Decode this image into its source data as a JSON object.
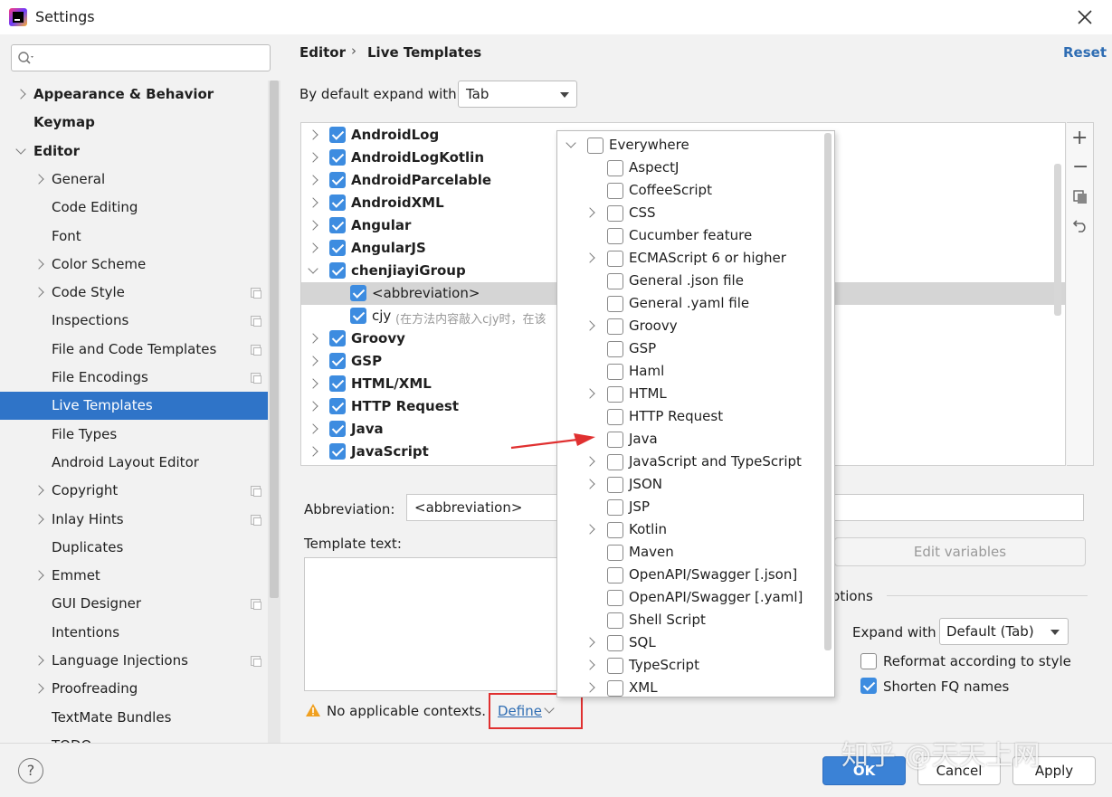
{
  "window": {
    "title": "Settings",
    "close_icon": "close-icon"
  },
  "search": {
    "placeholder": "",
    "value": ""
  },
  "nav": {
    "items": [
      {
        "label": "Appearance & Behavior",
        "level": 0,
        "bold": true,
        "expander": "right",
        "badge": false
      },
      {
        "label": "Keymap",
        "level": 0,
        "bold": true,
        "expander": "none",
        "badge": false
      },
      {
        "label": "Editor",
        "level": 0,
        "bold": true,
        "expander": "down",
        "badge": false
      },
      {
        "label": "General",
        "level": 1,
        "bold": false,
        "expander": "right",
        "badge": false
      },
      {
        "label": "Code Editing",
        "level": 1,
        "bold": false,
        "expander": "none",
        "badge": false
      },
      {
        "label": "Font",
        "level": 1,
        "bold": false,
        "expander": "none",
        "badge": false
      },
      {
        "label": "Color Scheme",
        "level": 1,
        "bold": false,
        "expander": "right",
        "badge": false
      },
      {
        "label": "Code Style",
        "level": 1,
        "bold": false,
        "expander": "right",
        "badge": true
      },
      {
        "label": "Inspections",
        "level": 1,
        "bold": false,
        "expander": "none",
        "badge": true
      },
      {
        "label": "File and Code Templates",
        "level": 1,
        "bold": false,
        "expander": "none",
        "badge": true
      },
      {
        "label": "File Encodings",
        "level": 1,
        "bold": false,
        "expander": "none",
        "badge": true
      },
      {
        "label": "Live Templates",
        "level": 1,
        "bold": false,
        "expander": "none",
        "badge": false,
        "selected": true
      },
      {
        "label": "File Types",
        "level": 1,
        "bold": false,
        "expander": "none",
        "badge": false
      },
      {
        "label": "Android Layout Editor",
        "level": 1,
        "bold": false,
        "expander": "none",
        "badge": false
      },
      {
        "label": "Copyright",
        "level": 1,
        "bold": false,
        "expander": "right",
        "badge": true
      },
      {
        "label": "Inlay Hints",
        "level": 1,
        "bold": false,
        "expander": "right",
        "badge": true
      },
      {
        "label": "Duplicates",
        "level": 1,
        "bold": false,
        "expander": "none",
        "badge": false
      },
      {
        "label": "Emmet",
        "level": 1,
        "bold": false,
        "expander": "right",
        "badge": false
      },
      {
        "label": "GUI Designer",
        "level": 1,
        "bold": false,
        "expander": "none",
        "badge": true
      },
      {
        "label": "Intentions",
        "level": 1,
        "bold": false,
        "expander": "none",
        "badge": false
      },
      {
        "label": "Language Injections",
        "level": 1,
        "bold": false,
        "expander": "right",
        "badge": true
      },
      {
        "label": "Proofreading",
        "level": 1,
        "bold": false,
        "expander": "right",
        "badge": false
      },
      {
        "label": "TextMate Bundles",
        "level": 1,
        "bold": false,
        "expander": "none",
        "badge": false
      },
      {
        "label": "TODO",
        "level": 1,
        "bold": false,
        "expander": "none",
        "badge": false
      }
    ]
  },
  "header": {
    "crumb1": "Editor",
    "sep": "›",
    "crumb2": "Live Templates",
    "reset": "Reset"
  },
  "expand": {
    "label": "By default expand with",
    "value": "Tab"
  },
  "templates": [
    {
      "label": "AndroidLog",
      "bold": true,
      "expander": "right",
      "checked": true,
      "indent": 0
    },
    {
      "label": "AndroidLogKotlin",
      "bold": true,
      "expander": "right",
      "checked": true,
      "indent": 0
    },
    {
      "label": "AndroidParcelable",
      "bold": true,
      "expander": "right",
      "checked": true,
      "indent": 0
    },
    {
      "label": "AndroidXML",
      "bold": true,
      "expander": "right",
      "checked": true,
      "indent": 0
    },
    {
      "label": "Angular",
      "bold": true,
      "expander": "right",
      "checked": true,
      "indent": 0
    },
    {
      "label": "AngularJS",
      "bold": true,
      "expander": "right",
      "checked": true,
      "indent": 0
    },
    {
      "label": "chenjiayiGroup",
      "bold": true,
      "expander": "down",
      "checked": true,
      "indent": 0
    },
    {
      "label": "<abbreviation>",
      "bold": false,
      "expander": "none",
      "checked": true,
      "indent": 1,
      "selected": true
    },
    {
      "label": "cjy",
      "desc": "(在方法内容敲入cjy时，在该",
      "bold": false,
      "expander": "none",
      "checked": true,
      "indent": 1
    },
    {
      "label": "Groovy",
      "bold": true,
      "expander": "right",
      "checked": true,
      "indent": 0
    },
    {
      "label": "GSP",
      "bold": true,
      "expander": "right",
      "checked": true,
      "indent": 0
    },
    {
      "label": "HTML/XML",
      "bold": true,
      "expander": "right",
      "checked": true,
      "indent": 0
    },
    {
      "label": "HTTP Request",
      "bold": true,
      "expander": "right",
      "checked": true,
      "indent": 0
    },
    {
      "label": "Java",
      "bold": true,
      "expander": "right",
      "checked": true,
      "indent": 0
    },
    {
      "label": "JavaScript",
      "bold": true,
      "expander": "right",
      "checked": true,
      "indent": 0
    }
  ],
  "side_toolbar": {
    "add": "+",
    "remove": "−"
  },
  "form": {
    "abbr_label": "Abbreviation:",
    "abbr_value": "<abbreviation>",
    "template_label": "Template text:",
    "edit_vars": "Edit variables",
    "options_label": "Options",
    "expand_with_label": "Expand with",
    "expand_with_value": "Default (Tab)",
    "reformat_label": "Reformat according to style",
    "reformat_checked": false,
    "shorten_label": "Shorten FQ names",
    "shorten_checked": true,
    "warning_text": "No applicable contexts.",
    "define_label": "Define"
  },
  "context_popup": {
    "items": [
      {
        "label": "Everywhere",
        "expander": "down",
        "indent": 0
      },
      {
        "label": "AspectJ",
        "expander": "none",
        "indent": 1
      },
      {
        "label": "CoffeeScript",
        "expander": "none",
        "indent": 1
      },
      {
        "label": "CSS",
        "expander": "right",
        "indent": 1
      },
      {
        "label": "Cucumber feature",
        "expander": "none",
        "indent": 1
      },
      {
        "label": "ECMAScript 6 or higher",
        "expander": "right",
        "indent": 1
      },
      {
        "label": "General .json file",
        "expander": "none",
        "indent": 1
      },
      {
        "label": "General .yaml file",
        "expander": "none",
        "indent": 1
      },
      {
        "label": "Groovy",
        "expander": "right",
        "indent": 1
      },
      {
        "label": "GSP",
        "expander": "none",
        "indent": 1
      },
      {
        "label": "Haml",
        "expander": "none",
        "indent": 1
      },
      {
        "label": "HTML",
        "expander": "right",
        "indent": 1
      },
      {
        "label": "HTTP Request",
        "expander": "none",
        "indent": 1
      },
      {
        "label": "Java",
        "expander": "none",
        "indent": 1
      },
      {
        "label": "JavaScript and TypeScript",
        "expander": "right",
        "indent": 1
      },
      {
        "label": "JSON",
        "expander": "right",
        "indent": 1
      },
      {
        "label": "JSP",
        "expander": "none",
        "indent": 1
      },
      {
        "label": "Kotlin",
        "expander": "right",
        "indent": 1
      },
      {
        "label": "Maven",
        "expander": "none",
        "indent": 1
      },
      {
        "label": "OpenAPI/Swagger [.json]",
        "expander": "none",
        "indent": 1
      },
      {
        "label": "OpenAPI/Swagger [.yaml]",
        "expander": "none",
        "indent": 1
      },
      {
        "label": "Shell Script",
        "expander": "none",
        "indent": 1
      },
      {
        "label": "SQL",
        "expander": "right",
        "indent": 1
      },
      {
        "label": "TypeScript",
        "expander": "right",
        "indent": 1
      },
      {
        "label": "XML",
        "expander": "right",
        "indent": 1
      }
    ]
  },
  "footer": {
    "help": "?",
    "ok": "OK",
    "cancel": "Cancel",
    "apply": "Apply"
  },
  "watermark": "知乎 @天天上网",
  "colors": {
    "accent": "#3d8ce0",
    "selection": "#2f74c8",
    "annotation": "#e03030"
  }
}
